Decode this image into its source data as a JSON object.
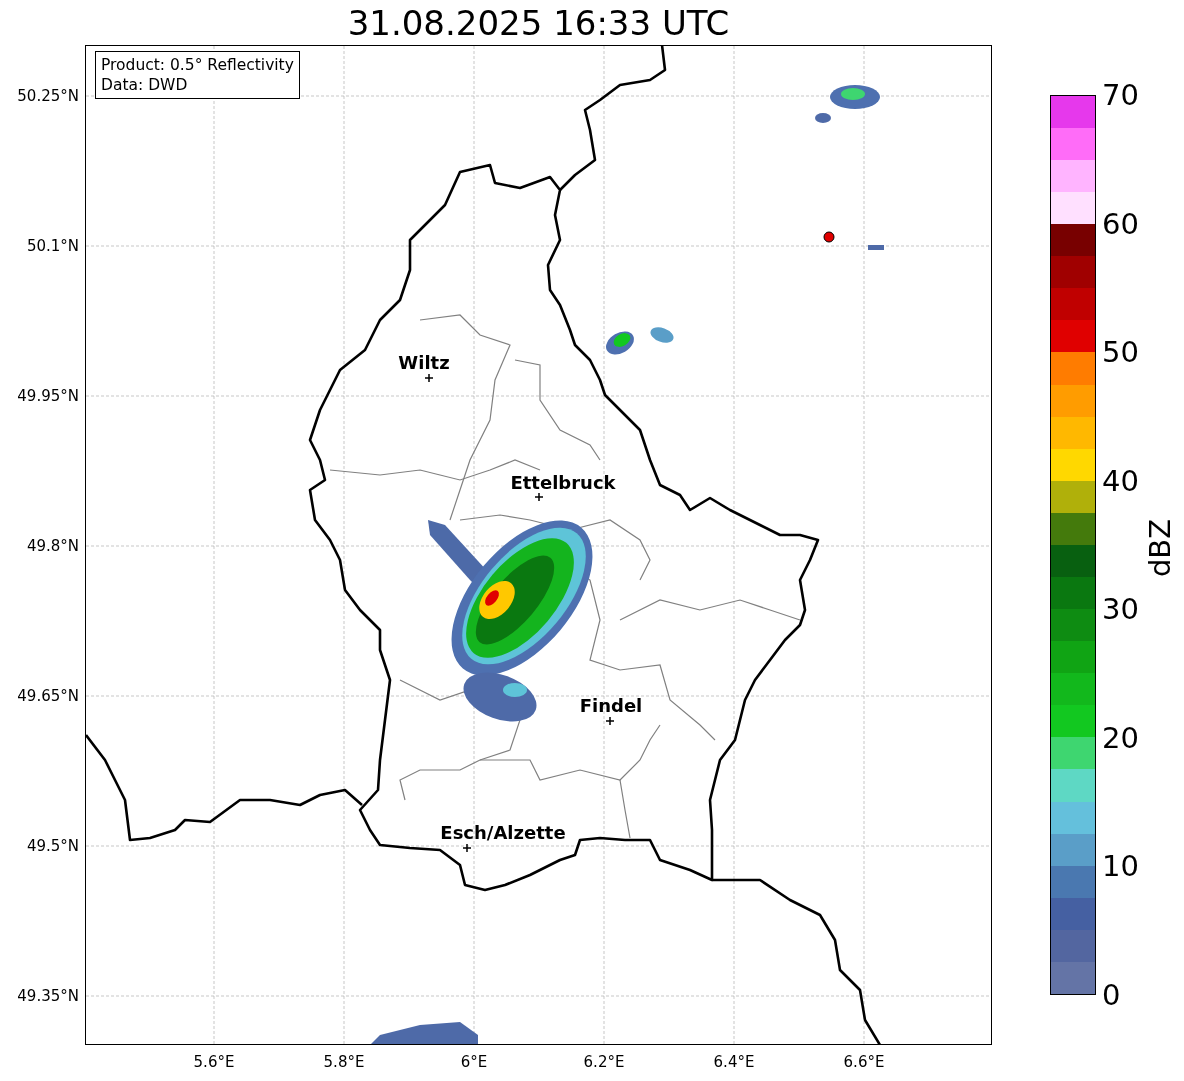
{
  "title": "31.08.2025 16:33 UTC",
  "info_box": {
    "lines": [
      "Product: 0.5° Reflectivity",
      "Data: DWD"
    ]
  },
  "map": {
    "yticks": [
      "50.25°N",
      "50.1°N",
      "49.95°N",
      "49.8°N",
      "49.65°N",
      "49.5°N",
      "49.35°N"
    ],
    "xticks": [
      "5.6°E",
      "5.8°E",
      "6°E",
      "6.2°E",
      "6.4°E",
      "6.6°E"
    ],
    "cities": [
      {
        "name": "Wiltz"
      },
      {
        "name": "Ettelbruck"
      },
      {
        "name": "Findel"
      },
      {
        "name": "Esch/Alzette"
      }
    ]
  },
  "colorbar": {
    "label": "dBZ",
    "ticks": [
      "70",
      "60",
      "50",
      "40",
      "30",
      "20",
      "10",
      "0"
    ],
    "bins": [
      {
        "color": "#6474a6"
      },
      {
        "color": "#5366a0"
      },
      {
        "color": "#4560a2"
      },
      {
        "color": "#4a78b0"
      },
      {
        "color": "#5a9ec8"
      },
      {
        "color": "#64c0dc"
      },
      {
        "color": "#5ed8c4"
      },
      {
        "color": "#3ed670"
      },
      {
        "color": "#12c820"
      },
      {
        "color": "#12b81c"
      },
      {
        "color": "#10a414"
      },
      {
        "color": "#0e8c12"
      },
      {
        "color": "#0a7810"
      },
      {
        "color": "#086010"
      },
      {
        "color": "#447a0c"
      },
      {
        "color": "#b0b00a"
      },
      {
        "color": "#ffd800"
      },
      {
        "color": "#ffb800"
      },
      {
        "color": "#ff9c00"
      },
      {
        "color": "#ff7c00"
      },
      {
        "color": "#e00000"
      },
      {
        "color": "#c00000"
      },
      {
        "color": "#a00000"
      },
      {
        "color": "#780000"
      },
      {
        "color": "#ffe0ff"
      },
      {
        "color": "#ffb4ff"
      },
      {
        "color": "#ff6cf8"
      },
      {
        "color": "#e638ec"
      }
    ]
  }
}
